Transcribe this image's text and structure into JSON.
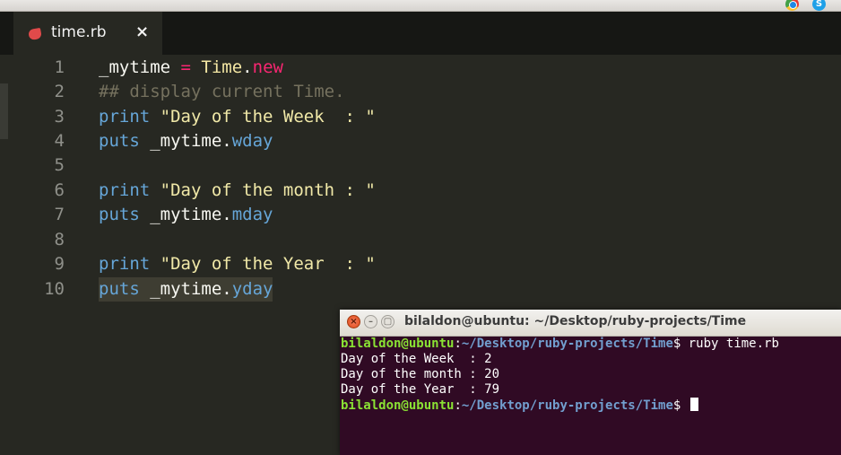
{
  "editor": {
    "tab_title": "time.rb",
    "tab_close": "×",
    "line_numbers": [
      "1",
      "2",
      "3",
      "4",
      "5",
      "6",
      "7",
      "8",
      "9",
      "10"
    ],
    "lines": {
      "l1": {
        "var": "_mytime",
        "op": " = ",
        "const": "Time",
        "dot": ".",
        "kw": "new"
      },
      "l2": {
        "comment": "## display current Time."
      },
      "l3": {
        "fn": "print",
        "str": " \"Day of the Week  : \""
      },
      "l4": {
        "fn": "puts",
        "rest": " _mytime.",
        "meth": "wday"
      },
      "l6": {
        "fn": "print",
        "str": " \"Day of the month : \""
      },
      "l7": {
        "fn": "puts",
        "rest": " _mytime.",
        "meth": "mday"
      },
      "l9": {
        "fn": "print",
        "str": " \"Day of the Year  : \""
      },
      "l10": {
        "fn": "puts",
        "rest": " _mytime.",
        "meth": "yday"
      }
    }
  },
  "terminal": {
    "title": "bilaldon@ubuntu: ~/Desktop/ruby-projects/Time",
    "close_label": "×",
    "min_label": "–",
    "max_label": "▢",
    "prompt_user": "bilaldon@ubuntu",
    "prompt_sep": ":",
    "prompt_path": "~/Desktop/ruby-projects/Time",
    "prompt_end": "$ ",
    "command": "ruby time.rb",
    "output": [
      "Day of the Week  : 2",
      "Day of the month : 20",
      "Day of the Year  : 79"
    ]
  },
  "system": {
    "skype_label": "S"
  },
  "colors": {
    "editor_bg": "#272822",
    "terminal_bg": "#300a24",
    "prompt_user": "#8ae234",
    "prompt_path": "#729fcf"
  }
}
